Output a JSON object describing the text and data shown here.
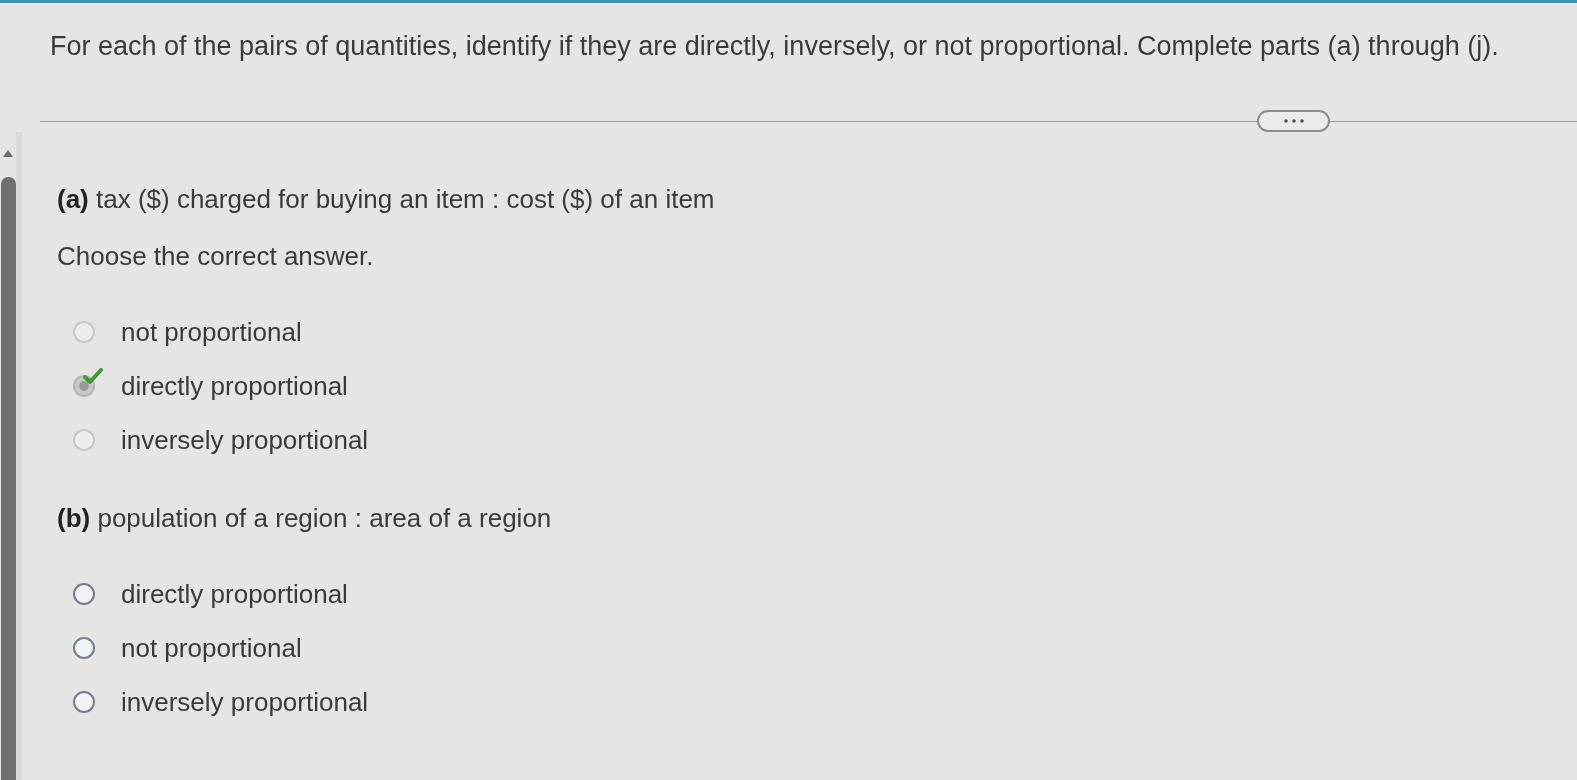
{
  "instructions": "For each of the pairs of quantities, identify if they are directly, inversely, or not proportional. Complete parts (a) through (j).",
  "parts": [
    {
      "prompt": "**(a)** tax ($) charged for buying an item : cost ($) of an item",
      "instruction": "Choose the correct answer.",
      "correct": true,
      "options": [
        {
          "text": "not proportional",
          "selected": false,
          "disabled": true
        },
        {
          "text": "directly proportional",
          "selected": true,
          "disabled": true
        },
        {
          "text": "inversely proportional",
          "selected": false,
          "disabled": true
        }
      ]
    },
    {
      "prompt": "**(b)** population of a region : area of a region",
      "options": [
        {
          "text": "directly proportional",
          "selected": false,
          "disabled": false
        },
        {
          "text": "not proportional",
          "selected": false,
          "disabled": false
        },
        {
          "text": "inversely proportional",
          "selected": false,
          "disabled": false
        }
      ]
    }
  ]
}
